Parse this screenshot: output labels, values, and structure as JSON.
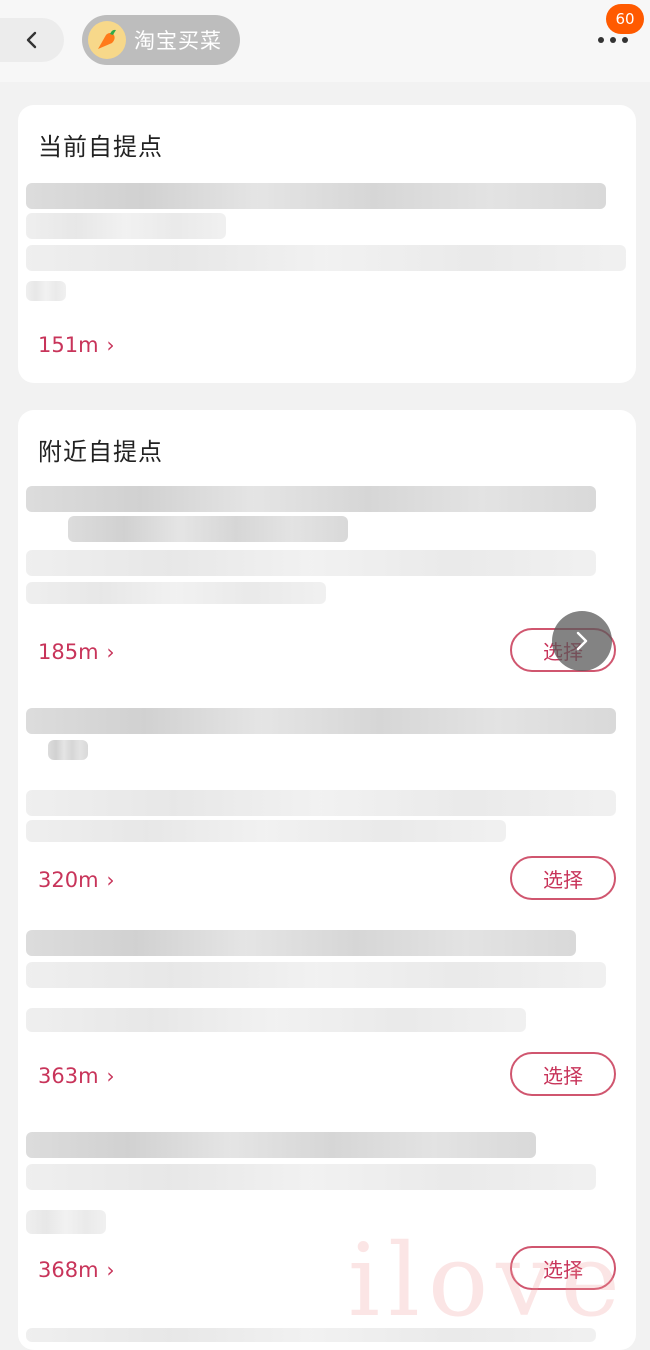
{
  "header": {
    "mini_program_title": "淘宝买菜",
    "badge_count": "60",
    "icons": [
      "chevron-left-icon",
      "carrot-logo-icon",
      "more-dots-icon"
    ]
  },
  "current": {
    "title": "当前自提点",
    "distance": "151m",
    "chevron": "›"
  },
  "nearby": {
    "title": "附近自提点",
    "items": [
      {
        "distance": "185m",
        "chevron": "›",
        "select_label": "选择"
      },
      {
        "distance": "320m",
        "chevron": "›",
        "select_label": "选择"
      },
      {
        "distance": "363m",
        "chevron": "›",
        "select_label": "选择"
      },
      {
        "distance": "368m",
        "chevron": "›",
        "select_label": "选择"
      }
    ]
  },
  "watermark": "ilove",
  "colors": {
    "accent": "#c8345a",
    "badge": "#ff5a00",
    "background": "#f2f2f2",
    "card": "#ffffff"
  }
}
